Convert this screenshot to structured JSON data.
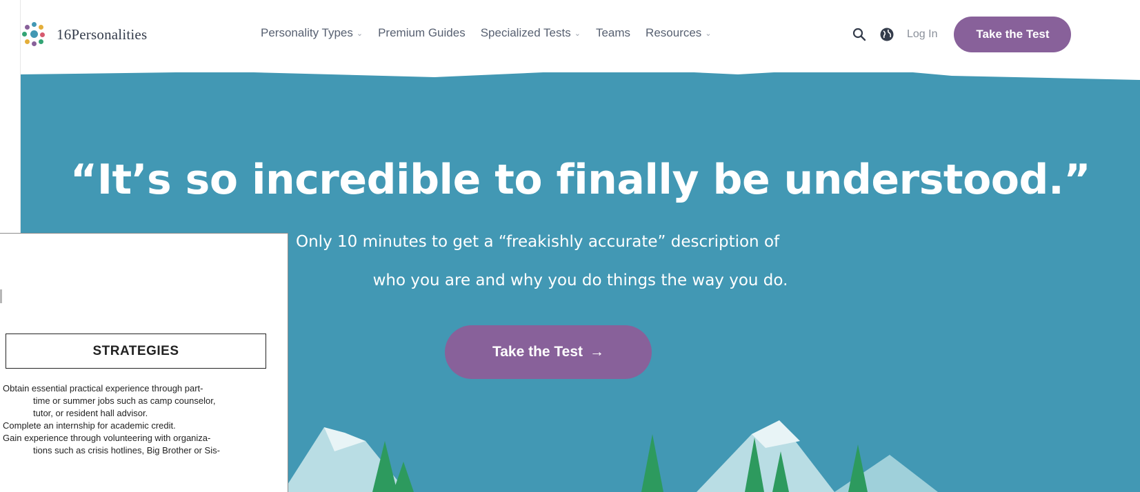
{
  "brand": {
    "name": "16Personalities",
    "colors": {
      "teal": "#4298b4",
      "purple": "#88619a",
      "text": "#343c4b"
    }
  },
  "nav": {
    "items": [
      {
        "label": "Personality Types",
        "has_dropdown": true
      },
      {
        "label": "Premium Guides",
        "has_dropdown": false
      },
      {
        "label": "Specialized Tests",
        "has_dropdown": true
      },
      {
        "label": "Teams",
        "has_dropdown": false
      },
      {
        "label": "Resources",
        "has_dropdown": true
      }
    ],
    "search_icon": "search-icon",
    "language_icon": "globe-icon",
    "login_label": "Log In",
    "cta_label": "Take the Test"
  },
  "hero": {
    "headline": "“It’s so incredible to finally be understood.”",
    "sub_line1": "Only 10 minutes to get a “freakishly accurate” description of",
    "sub_line2": "who you are and why you do things the way you do.",
    "cta_label": "Take the Test",
    "cta_arrow": "→"
  },
  "document": {
    "heading": "STRATEGIES",
    "lines": [
      {
        "text": "Obtain essential practical experience through part-",
        "indent": false
      },
      {
        "text": "time or summer jobs such as camp counselor,",
        "indent": true
      },
      {
        "text": "tutor, or resident hall advisor.",
        "indent": true
      },
      {
        "text": "Complete an internship for academic credit.",
        "indent": false
      },
      {
        "text": "Gain experience through volunteering with organiza-",
        "indent": false
      },
      {
        "text": "tions such as crisis hotlines, Big Brother or Sis-",
        "indent": true
      }
    ]
  }
}
